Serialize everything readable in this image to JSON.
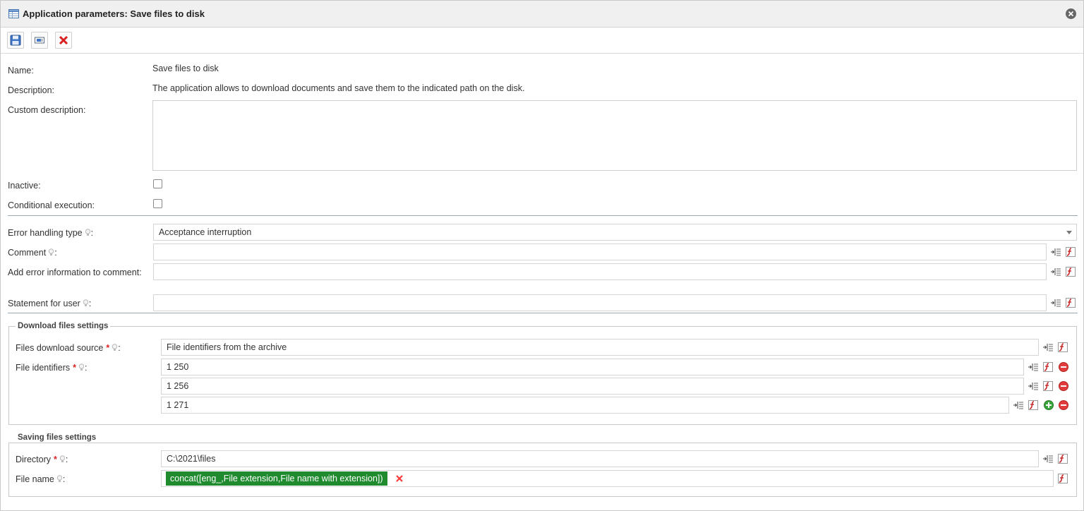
{
  "window": {
    "title": "Application parameters: Save files to disk"
  },
  "general": {
    "name_label": "Name:",
    "name_value": "Save files to disk",
    "description_label": "Description:",
    "description_value": "The application allows to download documents and save them to the indicated path on the disk.",
    "custom_description_label": "Custom description:",
    "custom_description_value": "",
    "inactive_label": "Inactive:",
    "conditional_label": "Conditional execution:"
  },
  "error": {
    "type_label": "Error handling type",
    "type_value": "Acceptance interruption",
    "comment_label": "Comment",
    "comment_value": "",
    "add_error_label": "Add error information to comment:",
    "add_error_value": "",
    "statement_label": "Statement for user",
    "statement_value": ""
  },
  "download": {
    "legend": "Download files settings",
    "source_label": "Files download source",
    "source_value": "File identifiers from the archive",
    "identifiers_label": "File identifiers",
    "identifiers": [
      "1 250",
      "1 256",
      "1 271"
    ]
  },
  "saving": {
    "legend": "Saving files settings",
    "directory_label": "Directory",
    "directory_value": "C:\\2021\\files",
    "filename_label": "File name",
    "filename_expr": "concat([eng_,File extension,File name with extension])"
  },
  "colors": {
    "token_bg": "#1f8a2e",
    "required": "#dd2222",
    "remove": "#e23b3b",
    "add": "#3aa53a"
  }
}
